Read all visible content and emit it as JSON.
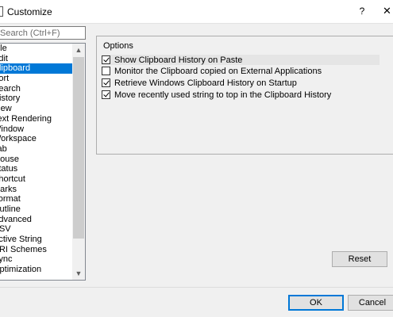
{
  "window": {
    "title": "Customize",
    "help_glyph": "?",
    "close_glyph": "✕"
  },
  "search": {
    "placeholder": "Search (Ctrl+F)",
    "visible_text": "earch (Ctrl+F)"
  },
  "categories": {
    "items": [
      "File",
      "Edit",
      "Clipboard",
      "Sort",
      "Search",
      "History",
      "View",
      "Text Rendering",
      "Window",
      "Workspace",
      "Tab",
      "Mouse",
      "Status",
      "Shortcut",
      "Marks",
      "Format",
      "Outline",
      "Advanced",
      "CSV",
      "Active String",
      "URI Schemes",
      "Sync",
      "Optimization"
    ],
    "selected_index": 2
  },
  "options": {
    "header": "Options",
    "items": [
      {
        "label": "Show Clipboard History on Paste",
        "checked": true
      },
      {
        "label": "Monitor the Clipboard copied on External Applications",
        "checked": false
      },
      {
        "label": "Retrieve Windows Clipboard History on Startup",
        "checked": true
      },
      {
        "label": "Move recently used string to top in the Clipboard History",
        "checked": true
      }
    ]
  },
  "buttons": {
    "reset": "Reset",
    "ok": "OK",
    "cancel": "Cancel"
  },
  "colors": {
    "selection": "#0078d7",
    "dialog_bg": "#f0f0f0"
  }
}
